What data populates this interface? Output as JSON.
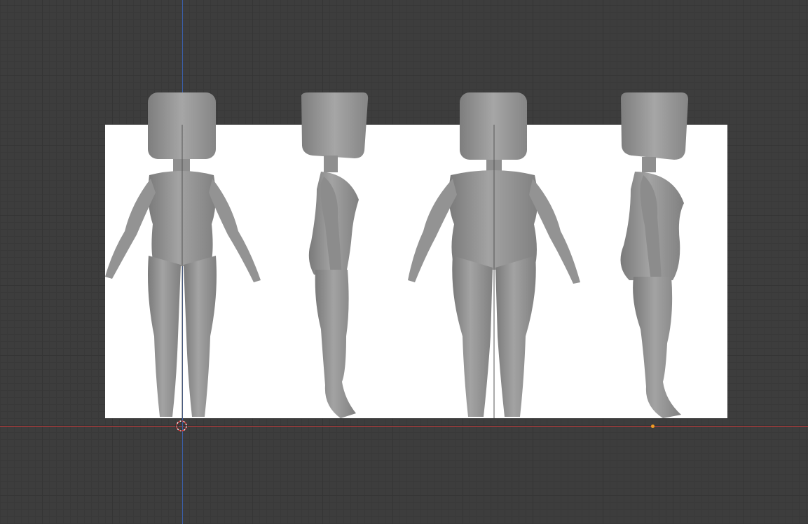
{
  "viewport": {
    "grid": "on",
    "background": "#3d3d3d",
    "axis_x_color": "#b23a3a",
    "axis_z_color": "#3b5fa8",
    "origin_color": "#f39c23",
    "reference_image_background": "#ffffff",
    "model_color": "#9a9a9a"
  },
  "icons": {
    "cursor": "3d-cursor-icon",
    "origin": "object-origin-icon"
  }
}
